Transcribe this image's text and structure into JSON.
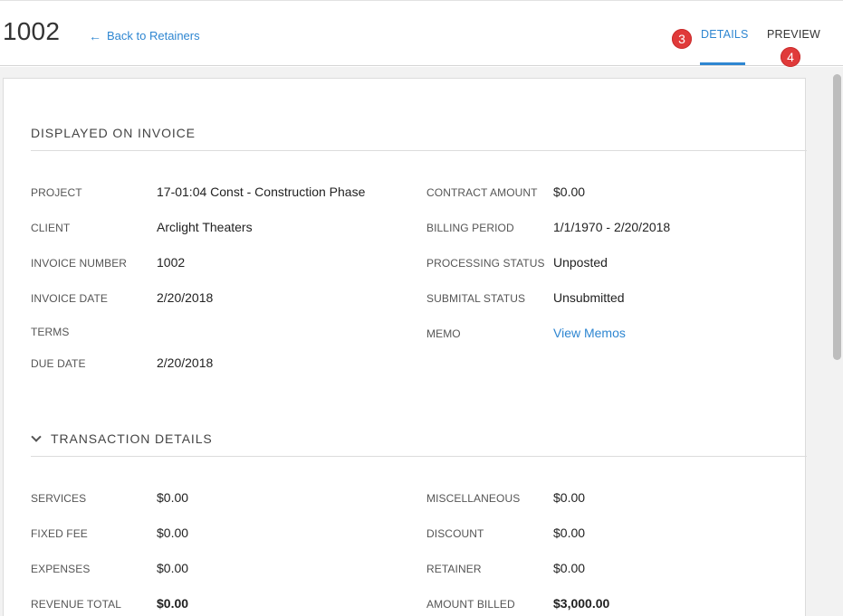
{
  "header": {
    "title": "1002",
    "back_link": "Back to Retainers",
    "tabs": [
      {
        "label": "DETAILS",
        "active": true,
        "badge": "3"
      },
      {
        "label": "PREVIEW",
        "active": false,
        "badge": "4"
      }
    ]
  },
  "displayed_on_invoice": {
    "title": "DISPLAYED ON INVOICE",
    "left": [
      {
        "label": "PROJECT",
        "value": "17-01:04 Const - Construction Phase"
      },
      {
        "label": "CLIENT",
        "value": "Arclight Theaters"
      },
      {
        "label": "INVOICE NUMBER",
        "value": "1002"
      },
      {
        "label": "INVOICE DATE",
        "value": "2/20/2018"
      },
      {
        "label": "TERMS",
        "value": ""
      },
      {
        "label": "DUE DATE",
        "value": "2/20/2018"
      }
    ],
    "right": [
      {
        "label": "CONTRACT AMOUNT",
        "value": "$0.00"
      },
      {
        "label": "BILLING PERIOD",
        "value": "1/1/1970 - 2/20/2018"
      },
      {
        "label": "PROCESSING STATUS",
        "value": "Unposted"
      },
      {
        "label": "SUBMITAL STATUS",
        "value": "Unsubmitted"
      },
      {
        "label": "MEMO",
        "value": "View Memos"
      }
    ]
  },
  "transaction_details": {
    "title": "TRANSACTION DETAILS",
    "left": [
      {
        "label": "SERVICES",
        "value": "$0.00"
      },
      {
        "label": "FIXED FEE",
        "value": "$0.00"
      },
      {
        "label": "EXPENSES",
        "value": "$0.00"
      },
      {
        "label": "REVENUE TOTAL",
        "value": "$0.00"
      }
    ],
    "right": [
      {
        "label": "MISCELLANEOUS",
        "value": "$0.00"
      },
      {
        "label": "DISCOUNT",
        "value": "$0.00"
      },
      {
        "label": "RETAINER",
        "value": "$0.00"
      },
      {
        "label": "AMOUNT BILLED",
        "value": "$3,000.00"
      }
    ]
  },
  "colors": {
    "accent": "#2e86d1",
    "badge": "#e03a3a"
  }
}
